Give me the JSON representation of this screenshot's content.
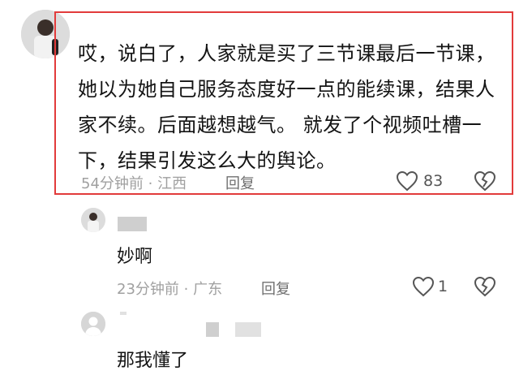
{
  "comments": [
    {
      "text": "哎，说白了，人家就是买了三节课最后一节课，她以为她自己服务态度好一点的能续课，结果人家不续。后面越想越气。 就发了个视频吐槽一下，结果引发这么大的舆论。",
      "time": "54分钟前",
      "location": "江西",
      "reply_label": "回复",
      "likes": "83"
    },
    {
      "text": "妙啊",
      "time": "23分钟前",
      "location": "广东",
      "reply_label": "回复",
      "likes": "1"
    },
    {
      "text": "那我懂了"
    }
  ],
  "colors": {
    "highlight_border": "#e23b3b",
    "meta_text": "#a0a0a0"
  }
}
